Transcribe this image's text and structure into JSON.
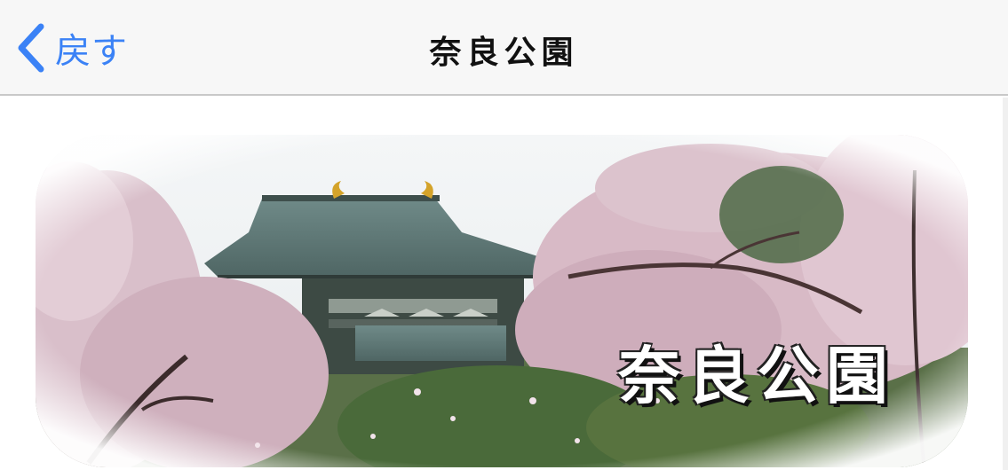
{
  "navbar": {
    "back_label": "戻す",
    "title": "奈良公園"
  },
  "banner": {
    "caption": "奈良公園"
  },
  "colors": {
    "accent": "#3b82f6",
    "navbar_bg": "#f7f7f7",
    "roof": "#5f7a78",
    "blossom": "#d9b6c4",
    "foliage": "#4c6b3a"
  }
}
